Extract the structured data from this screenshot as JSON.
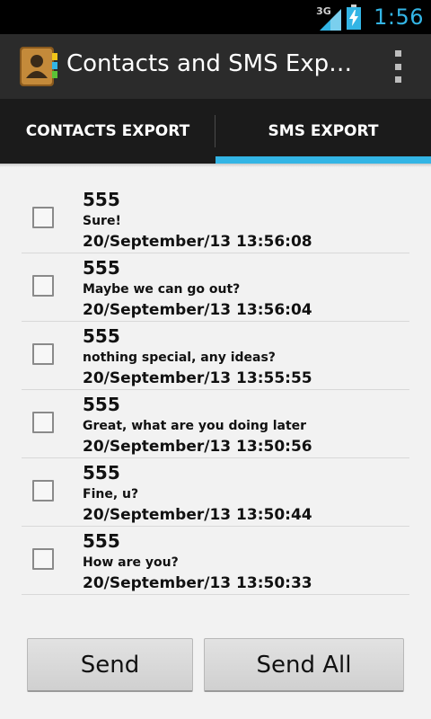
{
  "status_bar": {
    "network_label": "3G",
    "time": "1:56",
    "accent_color": "#33b5e5"
  },
  "action_bar": {
    "title": "Contacts and SMS Expo…",
    "app_icon": "contacts-book-icon",
    "overflow_icon": "overflow-menu-icon"
  },
  "tabs": [
    {
      "label": "CONTACTS EXPORT",
      "selected": false
    },
    {
      "label": "SMS EXPORT",
      "selected": true
    }
  ],
  "messages": [
    {
      "number": "555",
      "body": "Sure!",
      "datetime": "20/September/13  13:56:08",
      "checked": false
    },
    {
      "number": "555",
      "body": "Maybe we can go out?",
      "datetime": "20/September/13  13:56:04",
      "checked": false
    },
    {
      "number": "555",
      "body": "nothing special, any ideas?",
      "datetime": "20/September/13  13:55:55",
      "checked": false
    },
    {
      "number": "555",
      "body": "Great, what are you doing later",
      "datetime": "20/September/13  13:50:56",
      "checked": false
    },
    {
      "number": "555",
      "body": "Fine, u?",
      "datetime": "20/September/13  13:50:44",
      "checked": false
    },
    {
      "number": "555",
      "body": "How are you?",
      "datetime": "20/September/13  13:50:33",
      "checked": false
    }
  ],
  "buttons": {
    "send_label": "Send",
    "send_all_label": "Send All"
  }
}
